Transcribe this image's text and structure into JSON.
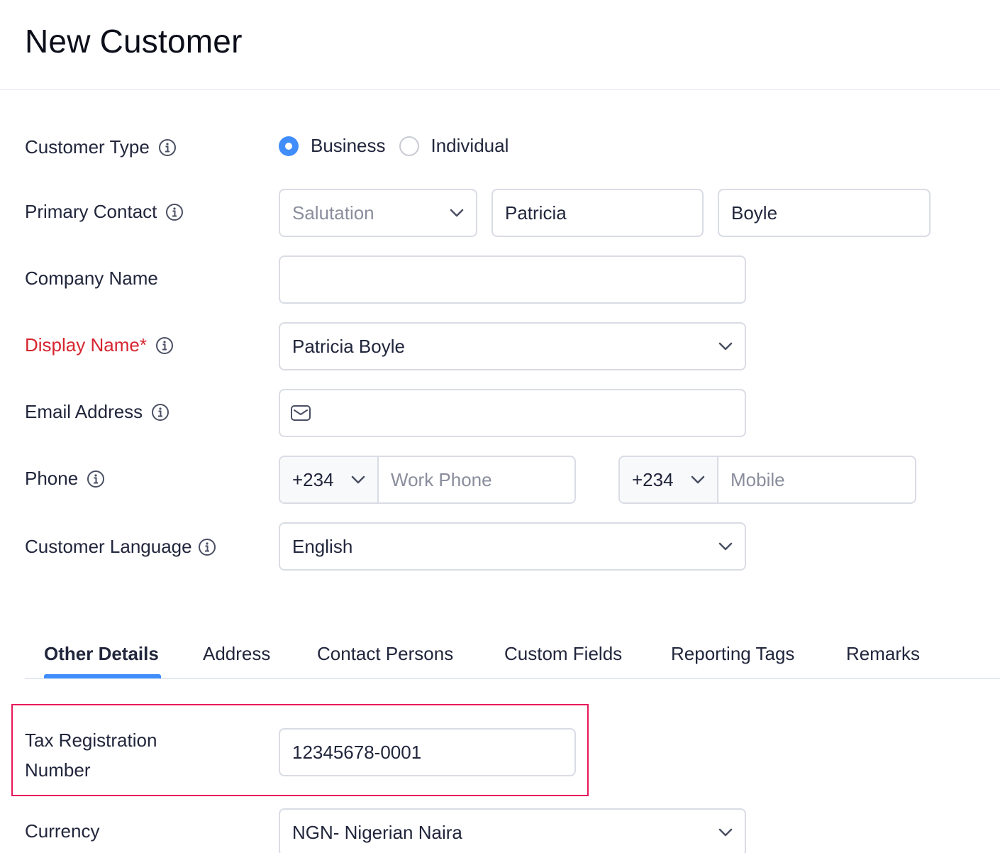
{
  "page": {
    "title": "New Customer"
  },
  "form": {
    "customer_type": {
      "label": "Customer Type",
      "options": [
        "Business",
        "Individual"
      ],
      "selected": "Business"
    },
    "primary_contact": {
      "label": "Primary Contact",
      "salutation_placeholder": "Salutation",
      "first_name": "Patricia",
      "last_name": "Boyle"
    },
    "company_name": {
      "label": "Company Name",
      "value": ""
    },
    "display_name": {
      "label": "Display Name*",
      "value": "Patricia Boyle"
    },
    "email": {
      "label": "Email Address",
      "value": ""
    },
    "phone": {
      "label": "Phone",
      "work_code": "+234",
      "work_placeholder": "Work Phone",
      "mobile_code": "+234",
      "mobile_placeholder": "Mobile"
    },
    "language": {
      "label": "Customer Language",
      "value": "English"
    }
  },
  "tabs": [
    {
      "label": "Other Details",
      "active": true
    },
    {
      "label": "Address"
    },
    {
      "label": "Contact Persons"
    },
    {
      "label": "Custom Fields"
    },
    {
      "label": "Reporting Tags"
    },
    {
      "label": "Remarks"
    }
  ],
  "other_details": {
    "tax_registration": {
      "label_line1": "Tax Registration",
      "label_line2": "Number",
      "value": "12345678-0001"
    },
    "currency": {
      "label": "Currency",
      "value": "NGN- Nigerian Naira"
    }
  },
  "colors": {
    "accent": "#408dfb",
    "required": "#d6252f",
    "highlight": "#e8195b",
    "border": "#dadce5"
  },
  "icons": {
    "info": "info-icon",
    "chevron": "chevron-down-icon",
    "email": "envelope-icon"
  }
}
